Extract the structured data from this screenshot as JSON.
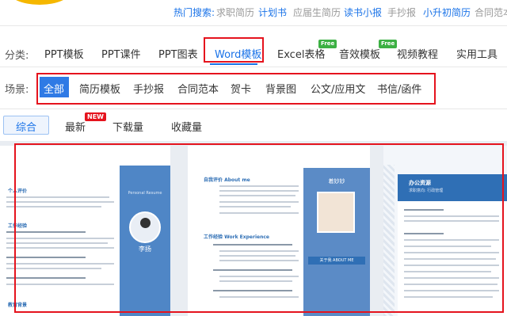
{
  "hot_search": {
    "label": "热门搜索:",
    "items": [
      {
        "text": "求职简历",
        "color": "#999999"
      },
      {
        "text": "计划书",
        "color": "#1a73e8"
      },
      {
        "text": "应届生简历",
        "color": "#999999"
      },
      {
        "text": "读书小报",
        "color": "#1a73e8"
      },
      {
        "text": "手抄报",
        "color": "#999999"
      },
      {
        "text": "小升初简历",
        "color": "#1a73e8"
      },
      {
        "text": "合同范本",
        "color": "#999999"
      }
    ]
  },
  "category": {
    "label": "分类:",
    "items": [
      {
        "text": "PPT模板",
        "active": false
      },
      {
        "text": "PPT课件",
        "active": false
      },
      {
        "text": "PPT图表",
        "active": false
      },
      {
        "text": "Word模板",
        "active": true
      },
      {
        "text": "Excel表格",
        "active": false,
        "badge": "Free"
      },
      {
        "text": "音效模板",
        "active": false,
        "badge": "Free"
      },
      {
        "text": "视频教程",
        "active": false
      },
      {
        "text": "实用工具",
        "active": false
      }
    ]
  },
  "scene": {
    "label": "场景:",
    "items": [
      {
        "text": "全部",
        "active": true
      },
      {
        "text": "简历模板",
        "active": false
      },
      {
        "text": "手抄报",
        "active": false
      },
      {
        "text": "合同范本",
        "active": false
      },
      {
        "text": "贺卡",
        "active": false
      },
      {
        "text": "背景图",
        "active": false
      },
      {
        "text": "公文/应用文",
        "active": false
      },
      {
        "text": "书信/函件",
        "active": false
      }
    ]
  },
  "sort": {
    "items": [
      {
        "text": "综合",
        "active": true
      },
      {
        "text": "最新",
        "active": false,
        "badge": "NEW"
      },
      {
        "text": "下载量",
        "active": false
      },
      {
        "text": "收藏量",
        "active": false
      }
    ]
  },
  "templates": [
    {
      "sections": [
        "个人评价",
        "工作经验",
        "教育背景"
      ],
      "side_title": "Personal Resume",
      "name": "李扬"
    },
    {
      "sections": [
        "自我评价 About me",
        "工作经验 Work Experience"
      ],
      "name": "着妙妙",
      "about": "关于我 ABOUT ME"
    },
    {
      "name": "办公资源",
      "sub": "求职意向: 行政管理"
    }
  ],
  "colors": {
    "accent": "#1a73e8",
    "highlight_border": "#e5131d",
    "free_badge": "#3cb043",
    "new_badge": "#e5131d"
  }
}
